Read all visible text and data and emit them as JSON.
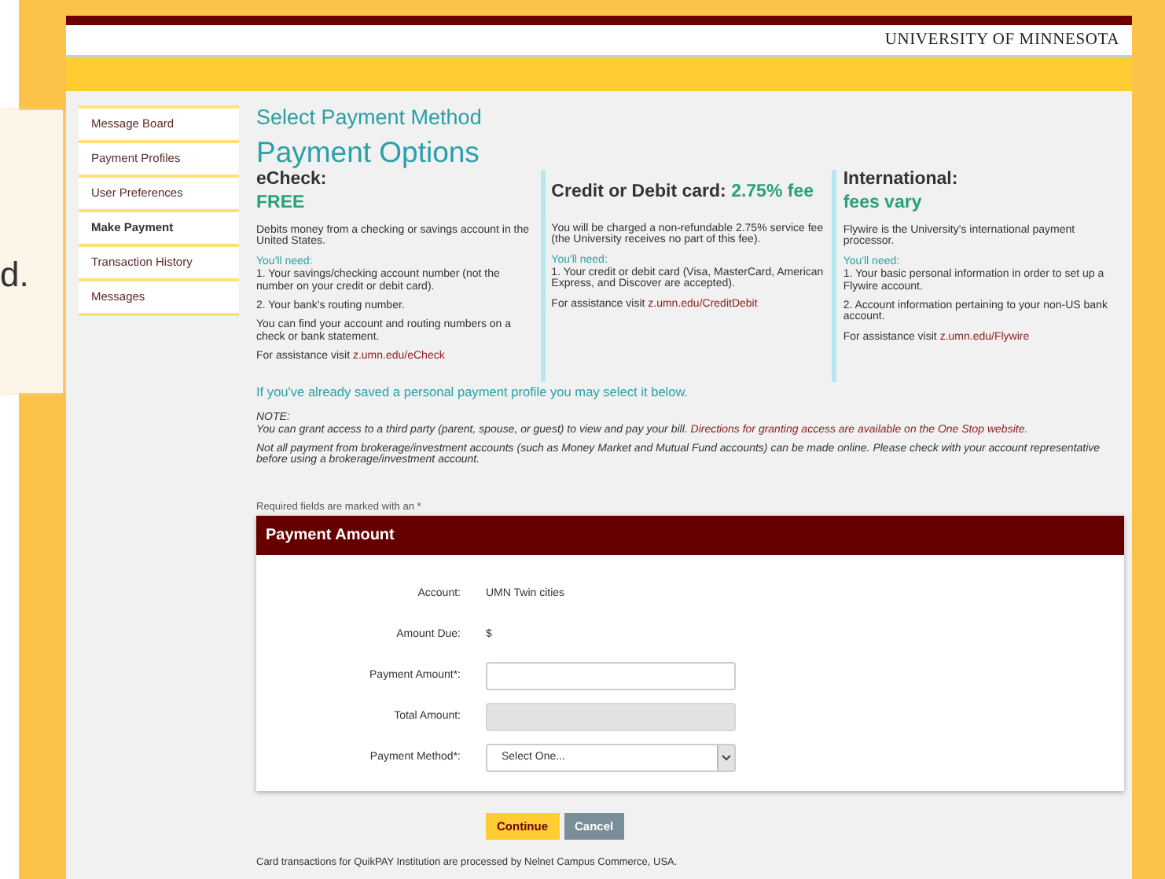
{
  "background_text": "d.",
  "header": {
    "brand": "UNIVERSITY OF MINNESOTA"
  },
  "sidebar": {
    "items": [
      {
        "label": "Message Board",
        "selected": false
      },
      {
        "label": "Payment Profiles",
        "selected": false
      },
      {
        "label": "User Preferences",
        "selected": false
      },
      {
        "label": "Make Payment",
        "selected": true
      },
      {
        "label": "Transaction History",
        "selected": false
      },
      {
        "label": "Messages",
        "selected": false
      }
    ]
  },
  "options": {
    "heading": "Select Payment Method",
    "title": "Payment Options",
    "methods": [
      {
        "kind": "stacked",
        "name": "eCheck:",
        "fee": "FREE",
        "description": "Debits money from a checking or savings account in the United States.",
        "need_label": "You'll need:",
        "needs": [
          "1. Your savings/checking account number (not the number on your credit or debit card).",
          "2. Your bank's routing number.",
          "You can find your account and routing numbers on a check or bank statement."
        ],
        "assistance": "For assistance visit ",
        "link": "z.umn.edu/eCheck"
      },
      {
        "kind": "inline",
        "name": "Credit or Debit card:",
        "fee": "2.75% fee",
        "description": "You will be charged a non-refundable 2.75% service fee (the University receives no part of this fee).",
        "need_label": "You'll need:",
        "needs": [
          "1. Your credit or debit card (Visa, MasterCard, American Express, and Discover are accepted)."
        ],
        "assistance": "For assistance visit ",
        "link": "z.umn.edu/CreditDebit"
      },
      {
        "kind": "stacked",
        "name": "International:",
        "fee": "fees vary",
        "description": "Flywire is the University's international payment processor.",
        "need_label": "You'll need:",
        "needs": [
          "1. Your basic personal information in order to set up a Flywire account.",
          "2. Account information pertaining to your non-US bank account."
        ],
        "assistance": "For assistance visit ",
        "link": "z.umn.edu/Flywire"
      }
    ],
    "profile_hint": "If you've already saved a personal payment profile you may select it below."
  },
  "notes": {
    "label": "NOTE:",
    "text": "You can grant access to a third party (parent, spouse, or guest) to view and pay your bill. ",
    "link": "Directions for granting access are available on the One Stop website.",
    "text_2": "Not all payment from brokerage/investment accounts (such as Money Market and Mutual Fund accounts) can be made online. Please check with your account representative before using a brokerage/investment account."
  },
  "form": {
    "required_hint": "Required fields are marked with an *",
    "title": "Payment Amount",
    "rows": [
      {
        "label": "Account:",
        "kind": "text",
        "value": "UMN Twin cities"
      },
      {
        "label": "Amount Due:",
        "kind": "text",
        "value": "$"
      },
      {
        "label": "Payment Amount*:",
        "kind": "input",
        "disabled": false
      },
      {
        "label": "Total Amount:",
        "kind": "input",
        "disabled": true
      },
      {
        "label": "Payment Method*:",
        "kind": "select",
        "value": "Select One..."
      }
    ],
    "buttons": [
      {
        "label": "Continue",
        "kind": "primary"
      },
      {
        "label": "Cancel",
        "kind": "secondary"
      }
    ]
  },
  "footer": "Card transactions for QuikPAY Institution are processed by Nelnet Campus Commerce, USA."
}
